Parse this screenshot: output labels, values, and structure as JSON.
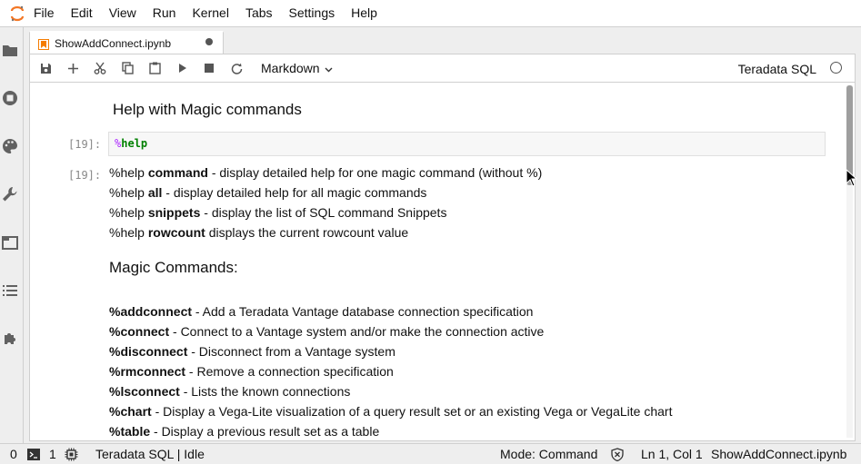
{
  "menubar": {
    "items": [
      "File",
      "Edit",
      "View",
      "Run",
      "Kernel",
      "Tabs",
      "Settings",
      "Help"
    ]
  },
  "sidebar": {
    "icons": [
      "folder-icon",
      "running-icon",
      "palette-icon",
      "wrench-icon",
      "tabs-icon",
      "list-icon",
      "extension-icon"
    ]
  },
  "tab": {
    "label": "ShowAddConnect.ipynb"
  },
  "toolbar": {
    "cell_type": "Markdown",
    "kernel_name": "Teradata SQL"
  },
  "notebook": {
    "heading": "Help with Magic commands",
    "input_prompt": "[19]:",
    "output_prompt": "[19]:",
    "code_percent": "%",
    "code_command": "help",
    "help_lines": [
      {
        "prefix": "%help ",
        "bold": "command",
        "suffix": " - display detailed help for one magic command (without %)"
      },
      {
        "prefix": "%help ",
        "bold": "all",
        "suffix": " - display detailed help for all magic commands"
      },
      {
        "prefix": "%help ",
        "bold": "snippets",
        "suffix": " - display the list of SQL command Snippets"
      },
      {
        "prefix": "%help ",
        "bold": "rowcount",
        "suffix": " displays the current rowcount value"
      }
    ],
    "magic_heading": "Magic Commands:",
    "magic_lines": [
      {
        "bold": "%addconnect",
        "suffix": " - Add a Teradata Vantage database connection specification"
      },
      {
        "bold": "%connect",
        "suffix": " - Connect to a Vantage system and/or make the connection active"
      },
      {
        "bold": "%disconnect",
        "suffix": " - Disconnect from a Vantage system"
      },
      {
        "bold": "%rmconnect",
        "suffix": " - Remove a connection specification"
      },
      {
        "bold": "%lsconnect",
        "suffix": " - Lists the known connections"
      },
      {
        "bold": "%chart",
        "suffix": " - Display a Vega-Lite visualization of a query result set or an existing Vega or VegaLite chart"
      },
      {
        "bold": "%table",
        "suffix": " - Display a previous result set as a table"
      }
    ]
  },
  "statusbar": {
    "terminals": "0",
    "kernels": "1",
    "kernel_status": "Teradata SQL | Idle",
    "mode": "Mode: Command",
    "position": "Ln 1, Col 1",
    "filename": "ShowAddConnect.ipynb"
  },
  "colors": {
    "logo_orange": "#f37726",
    "code_percent": "#aa22ff",
    "code_keyword": "#008000",
    "notebook_icon": "#f57c00"
  }
}
